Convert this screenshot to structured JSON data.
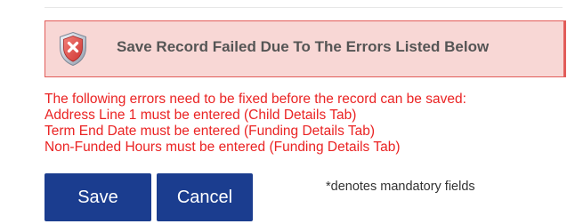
{
  "banner": {
    "icon": "shield-x-icon",
    "message": "Save Record Failed Due To The Errors Listed Below",
    "background_color": "#f8d7d5",
    "border_color": "#e25c59"
  },
  "errors": {
    "items": [
      "The following errors need to be fixed before the record can be saved:",
      "Address Line 1 must be entered (Child Details Tab)",
      "Term End Date must be entered (Funding Details Tab)",
      "Non-Funded Hours must be entered (Funding Details Tab)"
    ],
    "text_color": "#ea2323"
  },
  "actions": {
    "save_label": "Save",
    "cancel_label": "Cancel",
    "button_color": "#1b3d8f"
  },
  "note": {
    "mandatory": "*denotes mandatory fields"
  }
}
